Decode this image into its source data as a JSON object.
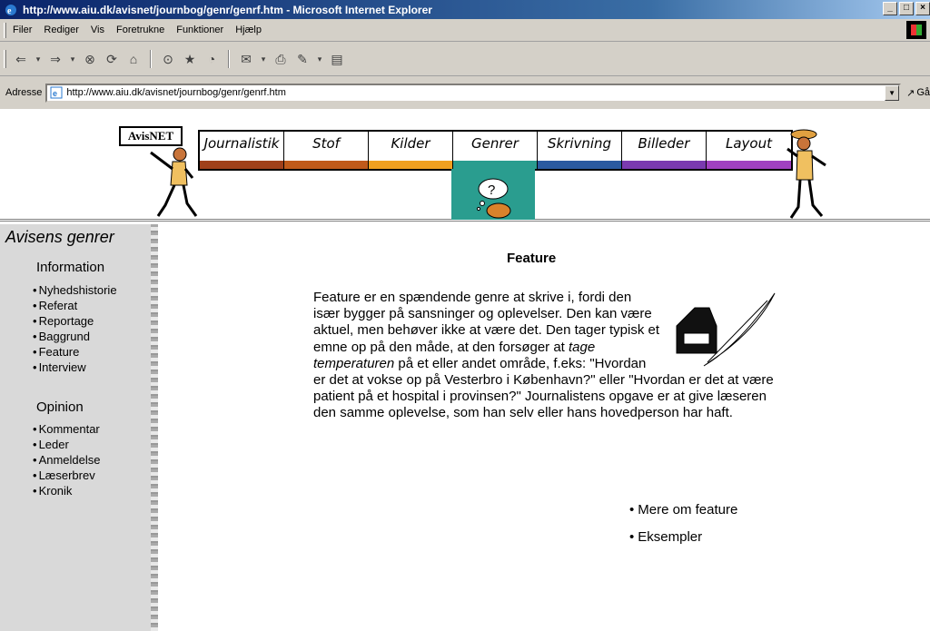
{
  "window": {
    "title": "http://www.aiu.dk/avisnet/journbog/genr/genrf.htm - Microsoft Internet Explorer"
  },
  "menu": [
    "Filer",
    "Rediger",
    "Vis",
    "Foretrukne",
    "Funktioner",
    "Hjælp"
  ],
  "address": {
    "label": "Adresse",
    "url": "http://www.aiu.dk/avisnet/journbog/genr/genrf.htm",
    "go": "Gå"
  },
  "banner": {
    "sign": "AvisNET",
    "nav": [
      {
        "label": "Journalistik",
        "color": "#a0401a"
      },
      {
        "label": "Stof",
        "color": "#c05a1a"
      },
      {
        "label": "Kilder",
        "color": "#f0a020"
      },
      {
        "label": "Genrer",
        "color": "#2a9d8f"
      },
      {
        "label": "Skrivning",
        "color": "#2a5aa0"
      },
      {
        "label": "Billeder",
        "color": "#7a3ab0"
      },
      {
        "label": "Layout",
        "color": "#a040c0"
      }
    ]
  },
  "sidebar": {
    "title": "Avisens genrer",
    "information_heading": "Information",
    "information_items": [
      "Nyhedshistorie",
      "Referat",
      "Reportage",
      "Baggrund",
      "Feature",
      "Interview"
    ],
    "opinion_heading": "Opinion",
    "opinion_items": [
      "Kommentar",
      "Leder",
      "Anmeldelse",
      "Læserbrev",
      "Kronik"
    ]
  },
  "content": {
    "title": "Feature",
    "text_before": "Feature er en spændende genre at skrive i, fordi den især bygger på sansninger og oplevelser. Den kan være aktuel, men behøver ikke at være det. Den tager typisk et emne op på den måde, at den forsøger at ",
    "text_italic": "tage temperaturen",
    "text_after": " på et eller andet område, f.eks: \"Hvordan er det at vokse op på Vesterbro i København?\" eller \"Hvordan er det at være patient på et hospital i provinsen?\" Journalistens opgave er at give læseren den samme oplevelse, som han selv eller hans hovedperson har haft.",
    "links": [
      "Mere om feature",
      "Eksempler"
    ]
  }
}
